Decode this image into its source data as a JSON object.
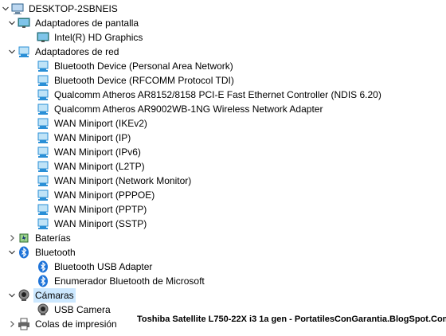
{
  "root": {
    "label": "DESKTOP-2SBNEIS"
  },
  "categories": [
    {
      "label": "Adaptadores de pantalla",
      "children": [
        "Intel(R) HD Graphics"
      ]
    },
    {
      "label": "Adaptadores de red",
      "children": [
        "Bluetooth Device (Personal Area Network)",
        "Bluetooth Device (RFCOMM Protocol TDI)",
        "Qualcomm Atheros AR8152/8158 PCI-E Fast Ethernet Controller (NDIS 6.20)",
        "Qualcomm Atheros AR9002WB-1NG Wireless Network Adapter",
        "WAN Miniport (IKEv2)",
        "WAN Miniport (IP)",
        "WAN Miniport (IPv6)",
        "WAN Miniport (L2TP)",
        "WAN Miniport (Network Monitor)",
        "WAN Miniport (PPPOE)",
        "WAN Miniport (PPTP)",
        "WAN Miniport (SSTP)"
      ]
    },
    {
      "label": "Baterías"
    },
    {
      "label": "Bluetooth",
      "children": [
        "Bluetooth USB Adapter",
        "Enumerador Bluetooth de Microsoft"
      ]
    },
    {
      "label": "Cámaras",
      "children": [
        "USB Camera"
      ]
    },
    {
      "label": "Colas de impresión"
    }
  ],
  "watermark": "Toshiba Satellite L750-22X i3 1a gen - PortatilesConGarantia.BlogSpot.Com",
  "colors": {
    "selection": "#cce8ff",
    "bluetooth": "#1e73d8",
    "network": "#2a8fd6"
  }
}
